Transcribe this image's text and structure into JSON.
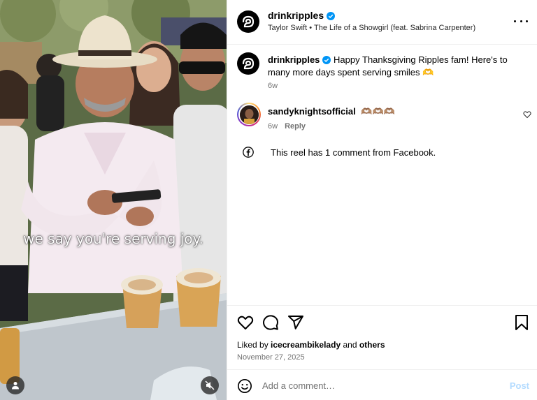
{
  "post": {
    "username": "drinkripples",
    "verified": true,
    "audio": "Taylor Swift • The Life of a Showgirl (feat. Sabrina Carpenter)",
    "caption_text": "Happy Thanksgiving Ripples fam! Here's to many more days spent serving smiles 🫶",
    "caption_time": "6w",
    "video_caption": "we say you're serving joy."
  },
  "comments": [
    {
      "username": "sandyknightsofficial",
      "text": "🫶🏽🫶🏽🫶🏽",
      "time": "6w",
      "reply_label": "Reply"
    }
  ],
  "facebook_note": "This reel has 1 comment from Facebook.",
  "likes": {
    "prefix": "Liked by",
    "user": "icecreambikelady",
    "joiner": "and",
    "others": "others"
  },
  "date": "November 27, 2025",
  "composer": {
    "placeholder": "Add a comment…",
    "post_label": "Post"
  },
  "icons": {
    "more": "more-horizontal-icon",
    "like": "heart-icon",
    "comment": "comment-icon",
    "share": "share-icon",
    "save": "bookmark-icon",
    "emoji": "emoji-icon",
    "facebook": "facebook-icon",
    "user": "user-tag-icon",
    "mute": "muted-speaker-icon"
  },
  "colors": {
    "verified": "#0095f6",
    "post_disabled": "#b3dbff",
    "secondary_text": "#737373"
  }
}
